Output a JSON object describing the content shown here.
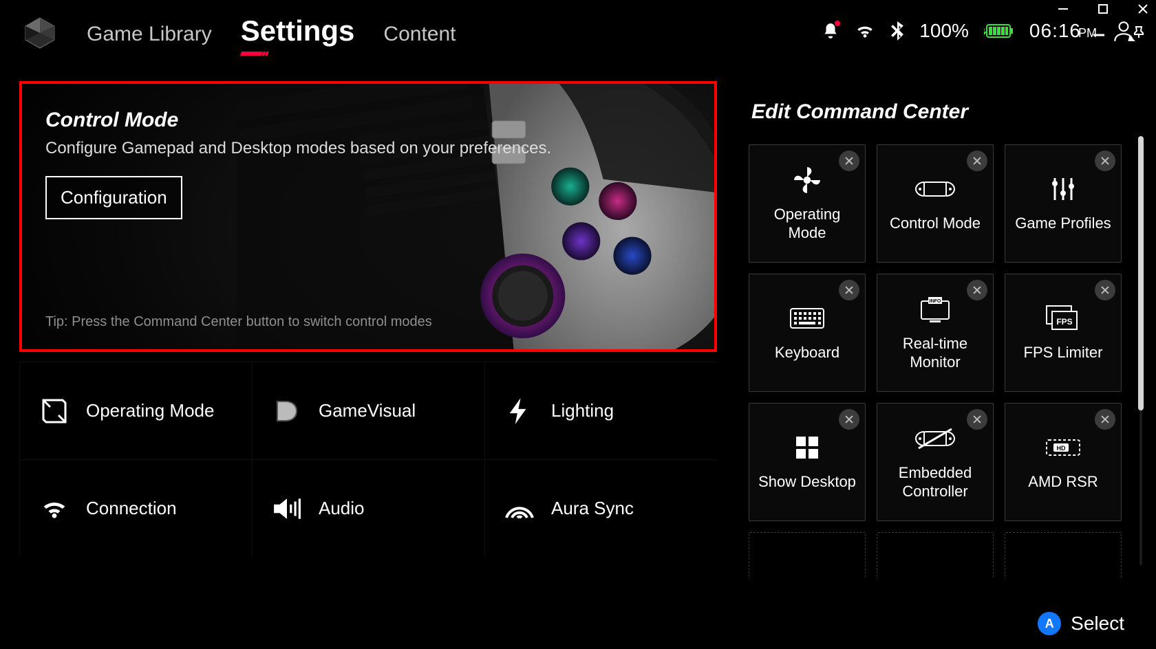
{
  "nav": {
    "items": [
      {
        "label": "Game Library"
      },
      {
        "label": "Settings"
      },
      {
        "label": "Content"
      }
    ],
    "active_index": 1
  },
  "status": {
    "battery_percent": "100%",
    "time": "06:16",
    "ampm": "PM"
  },
  "hero": {
    "title": "Control Mode",
    "description": "Configure Gamepad and Desktop modes based on your preferences.",
    "button_label": "Configuration",
    "tip": "Tip: Press the Command Center button to switch control modes"
  },
  "settings_tiles": [
    {
      "label": "Operating Mode",
      "icon": "operating-mode-icon"
    },
    {
      "label": "GameVisual",
      "icon": "gamevisual-icon"
    },
    {
      "label": "Lighting",
      "icon": "lighting-icon"
    },
    {
      "label": "Connection",
      "icon": "wifi-icon"
    },
    {
      "label": "Audio",
      "icon": "audio-icon"
    },
    {
      "label": "Aura Sync",
      "icon": "aura-sync-icon"
    }
  ],
  "command_center": {
    "title": "Edit Command Center",
    "tiles": [
      {
        "label": "Operating Mode",
        "icon": "fan-icon"
      },
      {
        "label": "Control Mode",
        "icon": "handheld-icon"
      },
      {
        "label": "Game Profiles",
        "icon": "sliders-icon"
      },
      {
        "label": "Keyboard",
        "icon": "keyboard-icon"
      },
      {
        "label": "Real-time Monitor",
        "icon": "monitor-info-icon"
      },
      {
        "label": "FPS Limiter",
        "icon": "fps-icon"
      },
      {
        "label": "Show Desktop",
        "icon": "windows-icon"
      },
      {
        "label": "Embedded Controller",
        "icon": "handheld-off-icon"
      },
      {
        "label": "AMD RSR",
        "icon": "hd-icon"
      }
    ],
    "empty_slots": 3
  },
  "bottom_hint": {
    "badge_letter": "A",
    "label": "Select"
  }
}
